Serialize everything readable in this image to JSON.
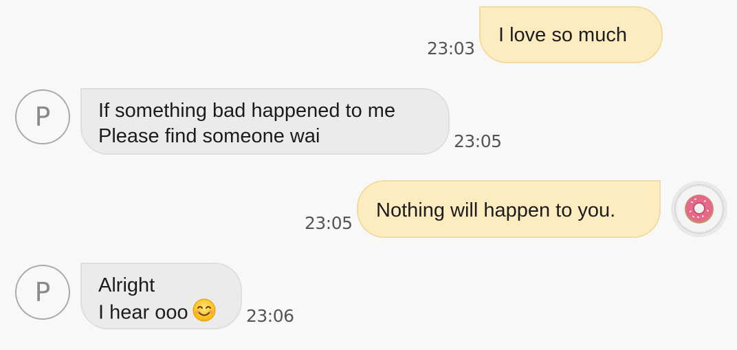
{
  "messages": [
    {
      "direction": "outgoing",
      "text": "I love so much",
      "time": "23:03"
    },
    {
      "direction": "incoming",
      "avatar_letter": "P",
      "lines": [
        "If something bad happened to me",
        "Please find someone wai"
      ],
      "time": "23:05"
    },
    {
      "direction": "outgoing",
      "text": "Nothing will happen to you.",
      "time": "23:05",
      "avatar": "donut-avatar"
    },
    {
      "direction": "incoming",
      "avatar_letter": "P",
      "lines": [
        "Alright",
        "I hear ooo"
      ],
      "emoji": "smiling-face-emoji",
      "time": "23:06"
    }
  ],
  "colors": {
    "background": "#f8f8f8",
    "outgoing_bubble": "#fdecc0",
    "incoming_bubble": "#ebebeb",
    "timestamp": "#555555"
  }
}
